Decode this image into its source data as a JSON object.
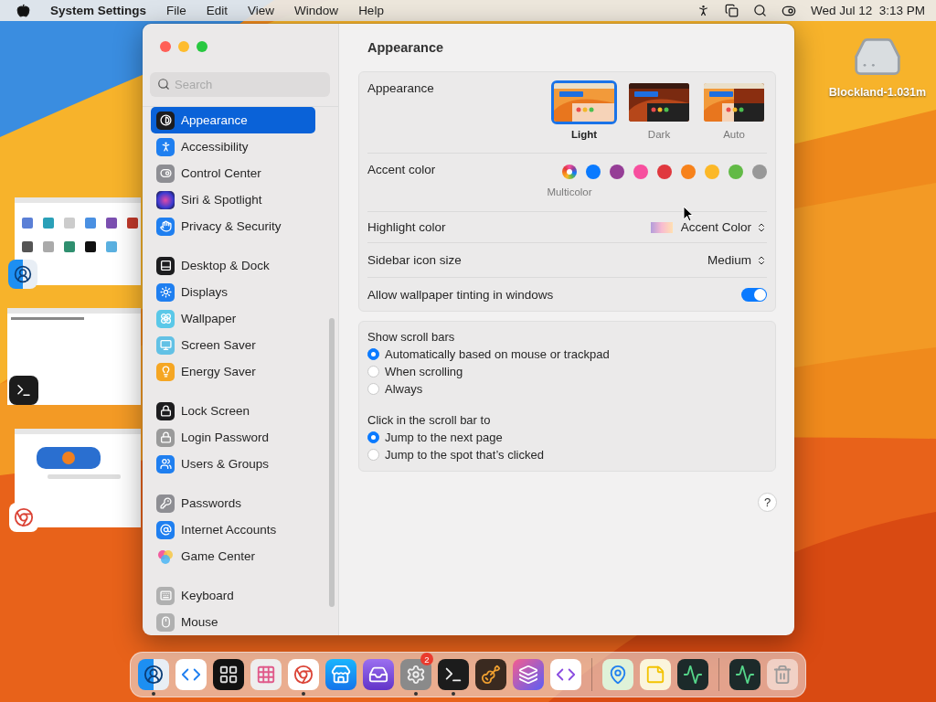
{
  "menu_bar": {
    "app_name": "System Settings",
    "menus": [
      "File",
      "Edit",
      "View",
      "Window",
      "Help"
    ],
    "clock": "Wed Jul 12  3:13 PM"
  },
  "desktop": {
    "drive_label": "Blockland-1.031m"
  },
  "window": {
    "title": "Appearance",
    "search": {
      "placeholder": "Search"
    },
    "sidebar": {
      "sections": [
        [
          {
            "label": "Appearance",
            "selected": true
          },
          {
            "label": "Accessibility",
            "selected": false
          },
          {
            "label": "Control Center",
            "selected": false
          },
          {
            "label": "Siri & Spotlight",
            "selected": false
          },
          {
            "label": "Privacy & Security",
            "selected": false
          }
        ],
        [
          {
            "label": "Desktop & Dock",
            "selected": false
          },
          {
            "label": "Displays",
            "selected": false
          },
          {
            "label": "Wallpaper",
            "selected": false
          },
          {
            "label": "Screen Saver",
            "selected": false
          },
          {
            "label": "Energy Saver",
            "selected": false
          }
        ],
        [
          {
            "label": "Lock Screen",
            "selected": false
          },
          {
            "label": "Login Password",
            "selected": false
          },
          {
            "label": "Users & Groups",
            "selected": false
          }
        ],
        [
          {
            "label": "Passwords",
            "selected": false
          },
          {
            "label": "Internet Accounts",
            "selected": false
          },
          {
            "label": "Game Center",
            "selected": false
          }
        ],
        [
          {
            "label": "Keyboard",
            "selected": false
          },
          {
            "label": "Mouse",
            "selected": false
          }
        ]
      ]
    },
    "appearance": {
      "label": "Appearance",
      "options": [
        {
          "label": "Light",
          "kind": "light",
          "selected": true
        },
        {
          "label": "Dark",
          "kind": "dark",
          "selected": false
        },
        {
          "label": "Auto",
          "kind": "auto",
          "selected": false
        }
      ]
    },
    "accent_color": {
      "label": "Accent color",
      "selected_name": "Multicolor",
      "colors": [
        {
          "kind": "multicolor",
          "selected": true
        },
        {
          "kind": "solid",
          "color": "#0a7aff",
          "selected": false
        },
        {
          "kind": "solid",
          "color": "#953d96",
          "selected": false
        },
        {
          "kind": "solid",
          "color": "#f74f9e",
          "selected": false
        },
        {
          "kind": "solid",
          "color": "#e0383e",
          "selected": false
        },
        {
          "kind": "solid",
          "color": "#f7821b",
          "selected": false
        },
        {
          "kind": "solid",
          "color": "#fcb827",
          "selected": false
        },
        {
          "kind": "solid",
          "color": "#62ba46",
          "selected": false
        },
        {
          "kind": "solid",
          "color": "#989898",
          "selected": false
        }
      ]
    },
    "highlight_color": {
      "label": "Highlight color",
      "value": "Accent Color"
    },
    "sidebar_icon_size": {
      "label": "Sidebar icon size",
      "value": "Medium"
    },
    "wallpaper_tinting": {
      "label": "Allow wallpaper tinting in windows",
      "on": true
    },
    "radio_groups": [
      {
        "title": "Show scroll bars",
        "options": [
          {
            "label": "Automatically based on mouse or trackpad",
            "selected": true
          },
          {
            "label": "When scrolling",
            "selected": false
          },
          {
            "label": "Always",
            "selected": false
          }
        ]
      },
      {
        "title": "Click in the scroll bar to",
        "options": [
          {
            "label": "Jump to the next page",
            "selected": true
          },
          {
            "label": "Jump to the spot that’s clicked",
            "selected": false
          }
        ]
      }
    ],
    "help": "?"
  },
  "dock": {
    "items": [
      {
        "kind": "app",
        "running": true
      },
      {
        "kind": "app",
        "running": false
      },
      {
        "kind": "app",
        "running": false
      },
      {
        "kind": "app",
        "running": false
      },
      {
        "kind": "app",
        "running": true
      },
      {
        "kind": "app",
        "running": false
      },
      {
        "kind": "app",
        "running": false
      },
      {
        "kind": "app",
        "running": true,
        "badge": "2"
      },
      {
        "kind": "app",
        "running": true
      },
      {
        "kind": "app",
        "running": false
      },
      {
        "kind": "app",
        "running": false
      },
      {
        "kind": "app",
        "running": false
      },
      {
        "kind": "separator"
      },
      {
        "kind": "app",
        "running": false
      },
      {
        "kind": "app",
        "running": false
      },
      {
        "kind": "app",
        "running": false
      },
      {
        "kind": "separator"
      },
      {
        "kind": "app",
        "running": false
      },
      {
        "kind": "app",
        "running": false
      }
    ]
  }
}
